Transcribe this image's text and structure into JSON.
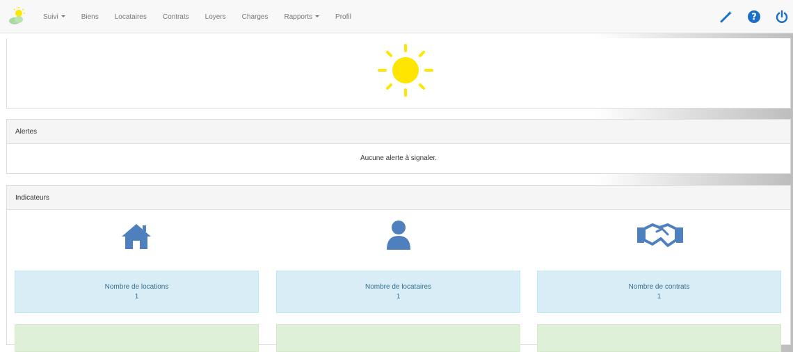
{
  "navbar": {
    "items": [
      {
        "label": "Suivi",
        "dropdown": true
      },
      {
        "label": "Biens",
        "dropdown": false
      },
      {
        "label": "Locataires",
        "dropdown": false
      },
      {
        "label": "Contrats",
        "dropdown": false
      },
      {
        "label": "Loyers",
        "dropdown": false
      },
      {
        "label": "Charges",
        "dropdown": false
      },
      {
        "label": "Rapports",
        "dropdown": true
      },
      {
        "label": "Profil",
        "dropdown": false
      }
    ],
    "right_icons": [
      "magic-wand-icon",
      "help-icon",
      "power-icon"
    ],
    "accent_color": "#1a6fc9"
  },
  "weather": {
    "icon": "sun-icon",
    "color": "#ffe600"
  },
  "alerts": {
    "title": "Alertes",
    "message": "Aucune alerte à signaler."
  },
  "indicators": {
    "title": "Indicateurs",
    "icon_color": "#4e80be",
    "cards": [
      {
        "icon": "house-icon",
        "label": "Nombre de locations",
        "value": "1"
      },
      {
        "icon": "user-icon",
        "label": "Nombre de locataires",
        "value": "1"
      },
      {
        "icon": "handshake-icon",
        "label": "Nombre de contrats",
        "value": "1"
      }
    ]
  }
}
